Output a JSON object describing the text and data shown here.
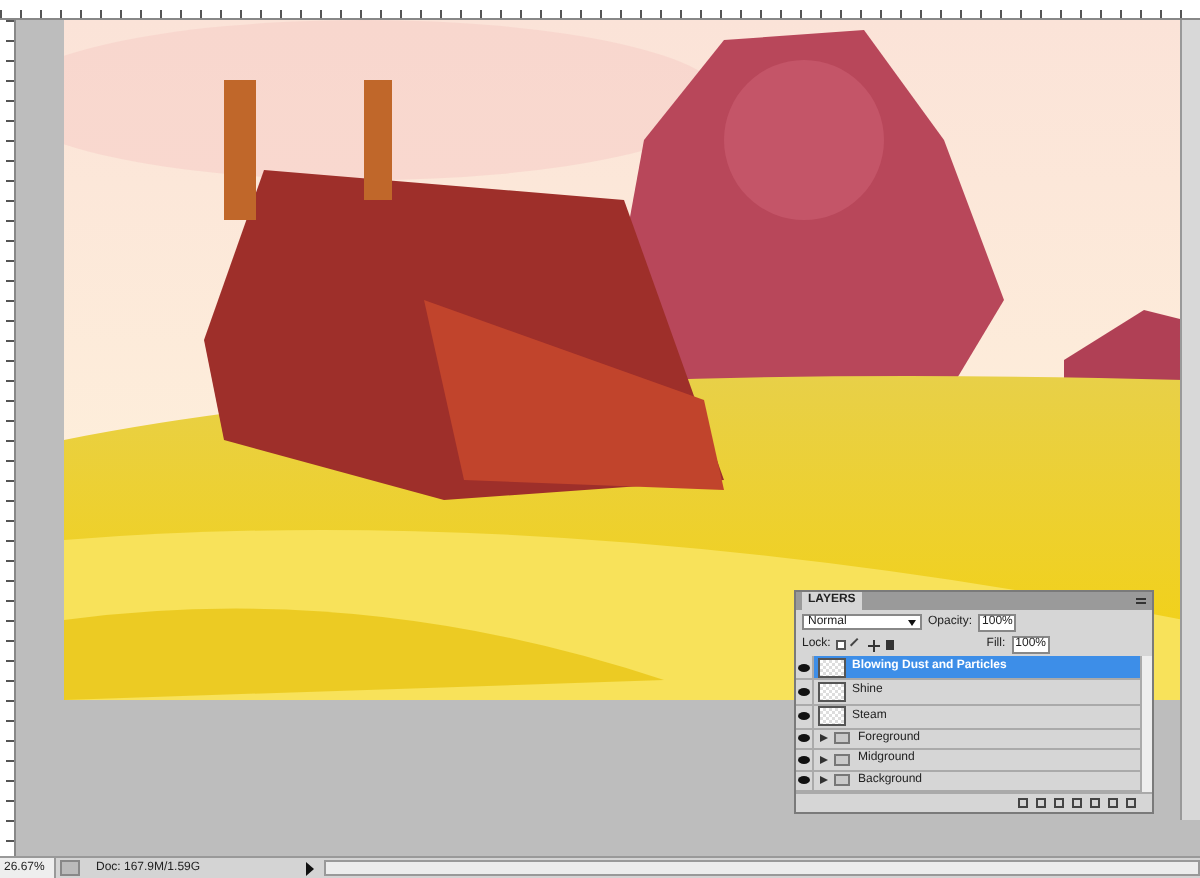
{
  "layers_panel": {
    "title": "LAYERS",
    "blend_mode": "Normal",
    "opacity_label": "Opacity:",
    "opacity": "100%",
    "lock_label": "Lock:",
    "fill_label": "Fill:",
    "fill": "100%",
    "layers": [
      {
        "name": "Blowing Dust and Particles",
        "kind": "layer",
        "selected": true,
        "visible": true
      },
      {
        "name": "Shine",
        "kind": "layer",
        "selected": false,
        "visible": true
      },
      {
        "name": "Steam",
        "kind": "layer",
        "selected": false,
        "visible": true
      },
      {
        "name": "Foreground",
        "kind": "group",
        "selected": false,
        "visible": true,
        "expanded": false
      },
      {
        "name": "Midground",
        "kind": "group",
        "selected": false,
        "visible": true,
        "expanded": false
      },
      {
        "name": "Background",
        "kind": "group",
        "selected": false,
        "visible": true,
        "expanded": false
      }
    ]
  },
  "status_bar": {
    "zoom": "26.67%",
    "doc_size": "Doc: 167.9M/1.59G"
  }
}
